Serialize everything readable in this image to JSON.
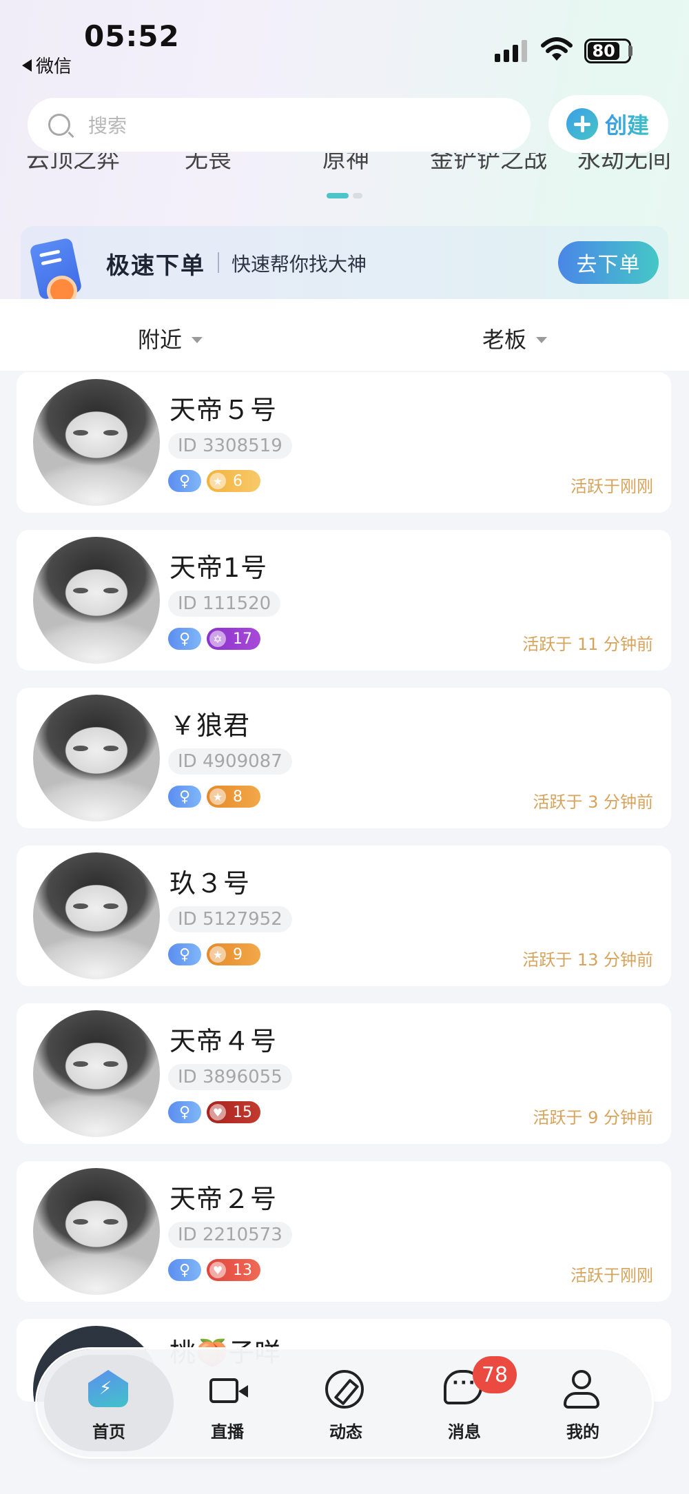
{
  "status_bar": {
    "time": "05:52",
    "back_label": "微信",
    "battery": "80"
  },
  "search": {
    "placeholder": "搜索"
  },
  "create_button": {
    "label": "创建"
  },
  "categories": [
    "云顶之弈",
    "无畏",
    "原神",
    "金铲铲之战",
    "永劫无间"
  ],
  "banner": {
    "title": "极速下单",
    "subtitle": "快速帮你找大神",
    "button": "去下单"
  },
  "filters": {
    "nearby": "附近",
    "role": "老板"
  },
  "users": [
    {
      "name": "天帝５号",
      "id": "ID 3308519",
      "level": "6",
      "active": "活跃于刚刚"
    },
    {
      "name": "天帝1号",
      "id": "ID 111520",
      "level": "17",
      "active": "活跃于 11 分钟前"
    },
    {
      "name": "￥狼君",
      "id": "ID 4909087",
      "level": "8",
      "active": "活跃于 3 分钟前"
    },
    {
      "name": "玖３号",
      "id": "ID 5127952",
      "level": "9",
      "active": "活跃于 13 分钟前"
    },
    {
      "name": "天帝４号",
      "id": "ID 3896055",
      "level": "15",
      "active": "活跃于 9 分钟前"
    },
    {
      "name": "天帝２号",
      "id": "ID 2210573",
      "level": "13",
      "active": "活跃于刚刚"
    },
    {
      "name": "桃🍑子咩"
    }
  ],
  "tab_bar": {
    "home": "首页",
    "live": "直播",
    "feed": "动态",
    "messages": "消息",
    "me": "我的",
    "messages_badge": "78"
  }
}
